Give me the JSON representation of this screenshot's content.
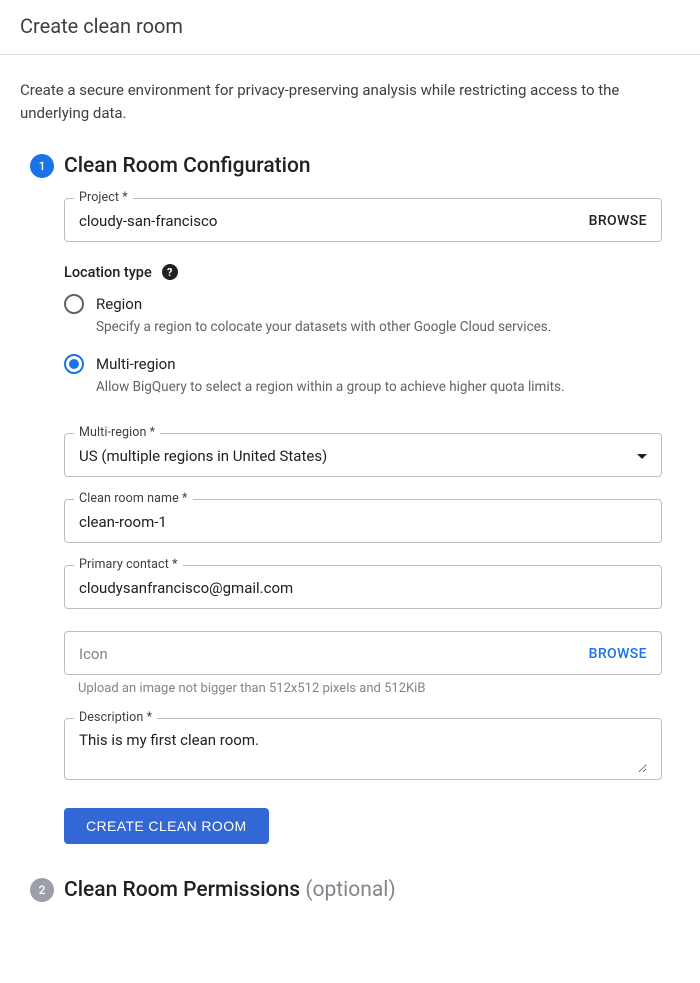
{
  "header": {
    "title": "Create clean room"
  },
  "intro": "Create a secure environment for privacy-preserving analysis while restricting access to the underlying data.",
  "steps": {
    "config": {
      "number": "1",
      "title": "Clean Room Configuration",
      "project": {
        "label": "Project *",
        "value": "cloudy-san-francisco",
        "browse": "BROWSE"
      },
      "location": {
        "heading": "Location type",
        "options": [
          {
            "label": "Region",
            "desc": "Specify a region to colocate your datasets with other Google Cloud services.",
            "checked": false
          },
          {
            "label": "Multi-region",
            "desc": "Allow BigQuery to select a region within a group to achieve higher quota limits.",
            "checked": true
          }
        ]
      },
      "multiRegion": {
        "label": "Multi-region *",
        "value": "US (multiple regions in United States)"
      },
      "roomName": {
        "label": "Clean room name *",
        "value": "clean-room-1"
      },
      "contact": {
        "label": "Primary contact *",
        "value": "cloudysanfrancisco@gmail.com"
      },
      "icon": {
        "placeholder": "Icon",
        "browse": "BROWSE",
        "helper": "Upload an image not bigger than 512x512 pixels and 512KiB"
      },
      "description": {
        "label": "Description *",
        "value": "This is my first clean room."
      },
      "submit": "CREATE CLEAN ROOM"
    },
    "permissions": {
      "number": "2",
      "title": "Clean Room Permissions",
      "optional": "(optional)"
    }
  }
}
